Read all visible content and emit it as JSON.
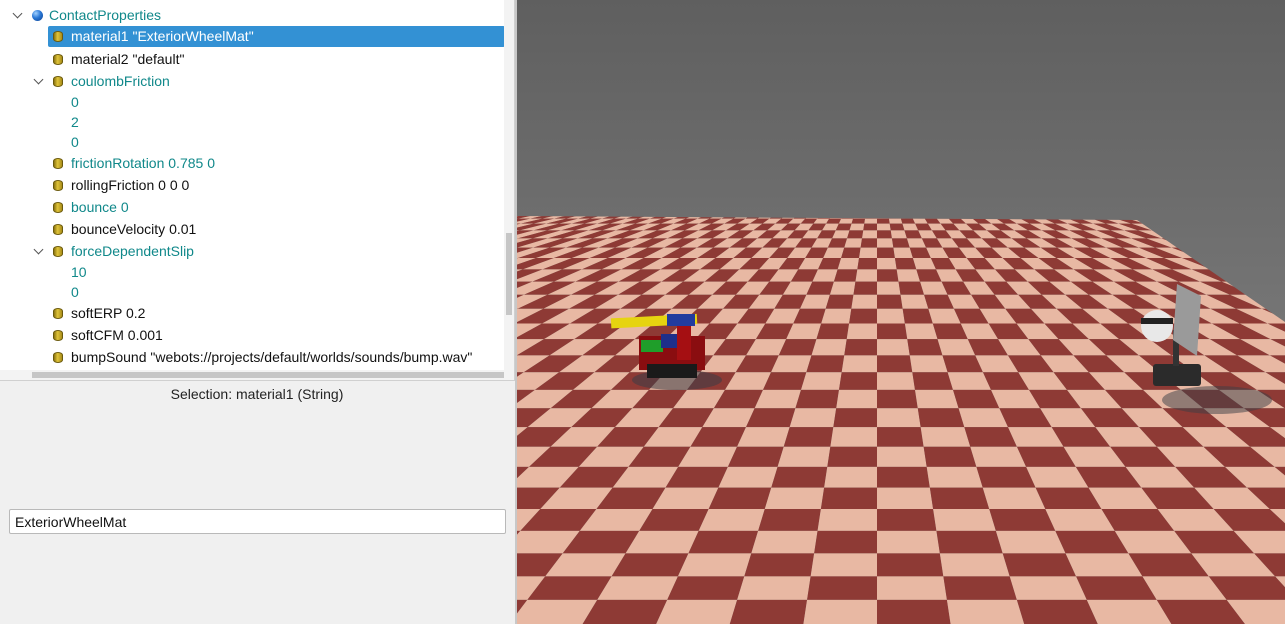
{
  "tree": {
    "root": {
      "label": "ContactProperties"
    },
    "rows": [
      {
        "label": "material1 \"ExteriorWheelMat\""
      },
      {
        "label": "material2 \"default\""
      },
      {
        "label": "coulombFriction"
      },
      {
        "label": "0"
      },
      {
        "label": "2"
      },
      {
        "label": "0"
      },
      {
        "label": "frictionRotation 0.785 0"
      },
      {
        "label": "rollingFriction 0 0 0"
      },
      {
        "label": "bounce 0"
      },
      {
        "label": "bounceVelocity 0.01"
      },
      {
        "label": "forceDependentSlip"
      },
      {
        "label": "10"
      },
      {
        "label": "0"
      },
      {
        "label": "softERP 0.2"
      },
      {
        "label": "softCFM 0.001"
      },
      {
        "label": "bumpSound \"webots://projects/default/worlds/sounds/bump.wav\""
      }
    ]
  },
  "selection": {
    "text": "Selection: material1 (String)"
  },
  "editor": {
    "value": "ExteriorWheelMat"
  },
  "colors": {
    "selection_bg": "#3391d4",
    "modified_field": "#10888a",
    "sky": "#6e6e6e",
    "checker_light": "#e8b8a3",
    "checker_dark": "#8e3a35"
  }
}
